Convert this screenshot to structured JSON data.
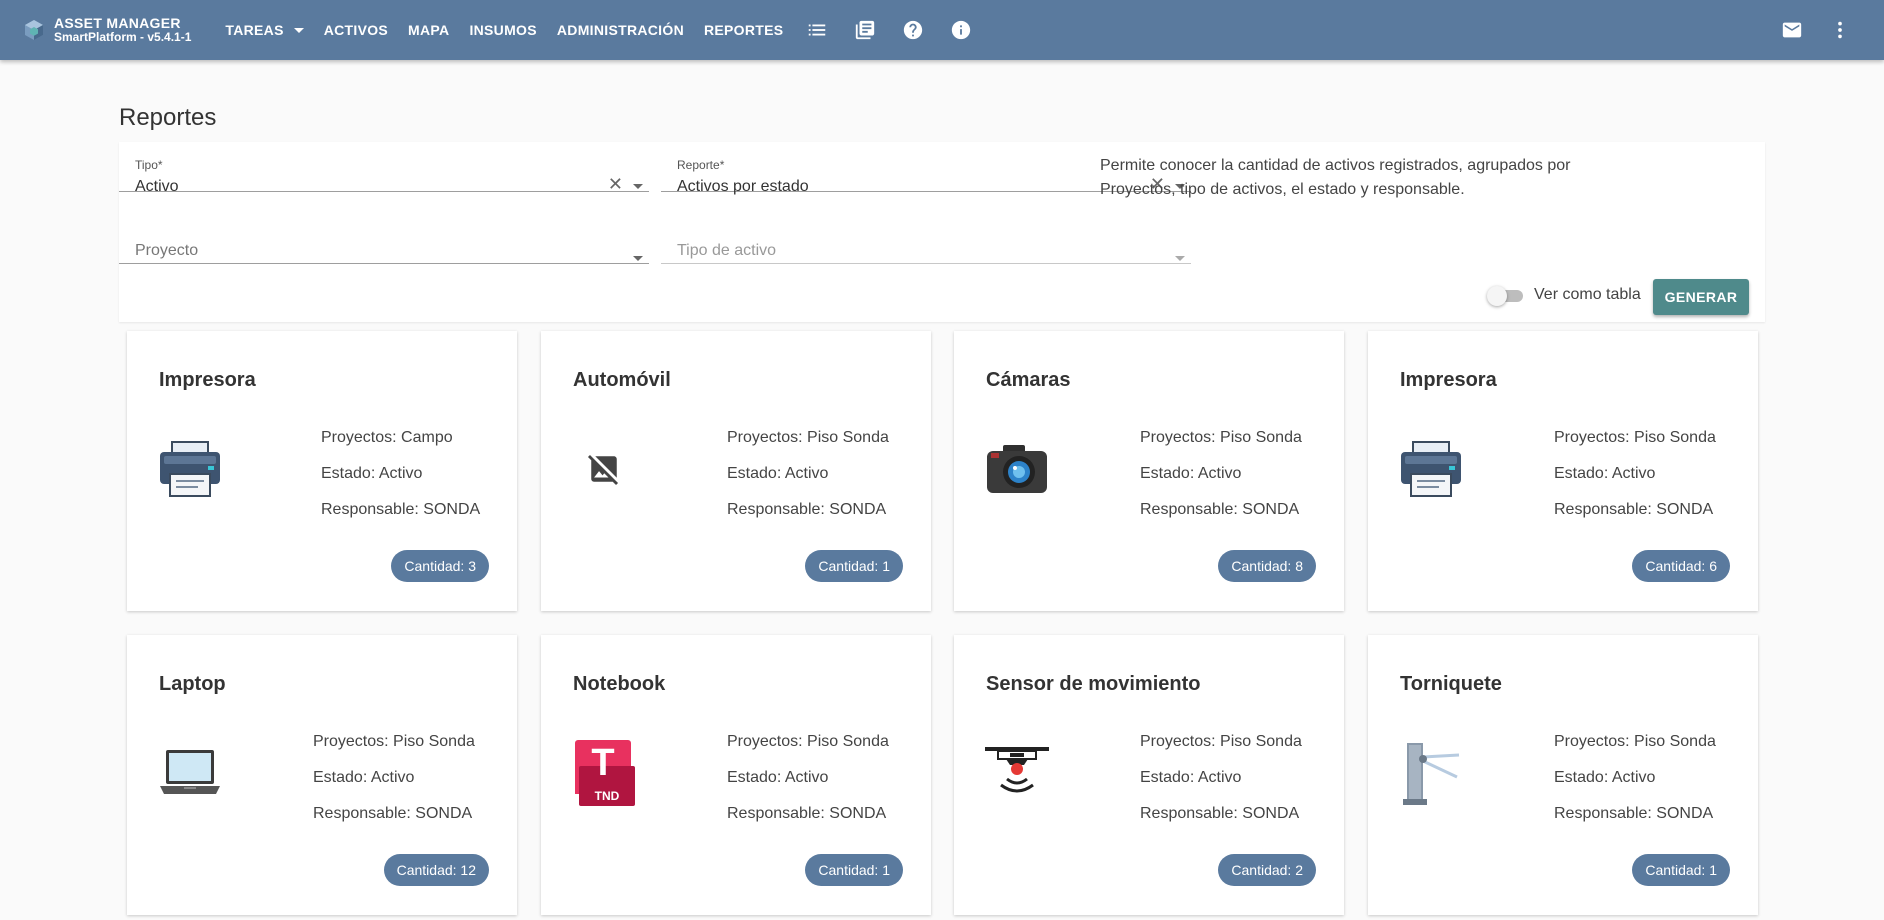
{
  "app": {
    "title": "ASSET MANAGER",
    "subtitle": "SmartPlatform - v5.4.1-1"
  },
  "nav": {
    "items": [
      "TAREAS",
      "ACTIVOS",
      "MAPA",
      "INSUMOS",
      "ADMINISTRACIÓN",
      "REPORTES"
    ],
    "icons": [
      "list-icon",
      "library-books-icon",
      "help-icon",
      "info-icon"
    ],
    "right_icons": [
      "mail-icon",
      "more-vert-icon"
    ]
  },
  "page": {
    "title": "Reportes"
  },
  "filters": {
    "tipo": {
      "label": "Tipo*",
      "value": "Activo"
    },
    "reporte": {
      "label": "Reporte*",
      "value": "Activos por estado"
    },
    "proyecto": {
      "placeholder": "Proyecto"
    },
    "tipo_activo": {
      "placeholder": "Tipo de activo"
    },
    "description": "Permite conocer la cantidad de activos registrados, agrupados por Proyectos, tipo de activos, el estado y responsable.",
    "toggle_label": "Ver como tabla",
    "toggle_on": false,
    "generate_label": "GENERAR"
  },
  "cards": [
    {
      "title": "Impresora",
      "icon": "printer-icon",
      "proyectos": "Proyectos: Campo",
      "estado": "Estado: Activo",
      "responsable": "Responsable: SONDA",
      "cantidad": "Cantidad: 3"
    },
    {
      "title": "Automóvil",
      "icon": "image-not-supported-icon",
      "proyectos": "Proyectos: Piso Sonda",
      "estado": "Estado: Activo",
      "responsable": "Responsable: SONDA",
      "cantidad": "Cantidad: 1"
    },
    {
      "title": "Cámaras",
      "icon": "camera-icon",
      "proyectos": "Proyectos: Piso Sonda",
      "estado": "Estado: Activo",
      "responsable": "Responsable: SONDA",
      "cantidad": "Cantidad: 8"
    },
    {
      "title": "Impresora",
      "icon": "printer-icon",
      "proyectos": "Proyectos: Piso Sonda",
      "estado": "Estado: Activo",
      "responsable": "Responsable: SONDA",
      "cantidad": "Cantidad: 6"
    },
    {
      "title": "Laptop",
      "icon": "laptop-icon",
      "proyectos": "Proyectos: Piso Sonda",
      "estado": "Estado: Activo",
      "responsable": "Responsable: SONDA",
      "cantidad": "Cantidad: 12"
    },
    {
      "title": "Notebook",
      "icon": "tnd-app-icon",
      "icon_text": "T",
      "icon_subtext": "TND",
      "proyectos": "Proyectos: Piso Sonda",
      "estado": "Estado: Activo",
      "responsable": "Responsable: SONDA",
      "cantidad": "Cantidad: 1"
    },
    {
      "title": "Sensor de movimiento",
      "icon": "motion-sensor-icon",
      "proyectos": "Proyectos: Piso Sonda",
      "estado": "Estado: Activo",
      "responsable": "Responsable: SONDA",
      "cantidad": "Cantidad: 2"
    },
    {
      "title": "Torniquete",
      "icon": "turnstile-icon",
      "proyectos": "Proyectos: Piso Sonda",
      "estado": "Estado: Activo",
      "responsable": "Responsable: SONDA",
      "cantidad": "Cantidad: 1"
    }
  ],
  "colors": {
    "topbar": "#5a7a9e",
    "badge": "#5a7a9e",
    "generate_button": "#4f8a8b"
  }
}
